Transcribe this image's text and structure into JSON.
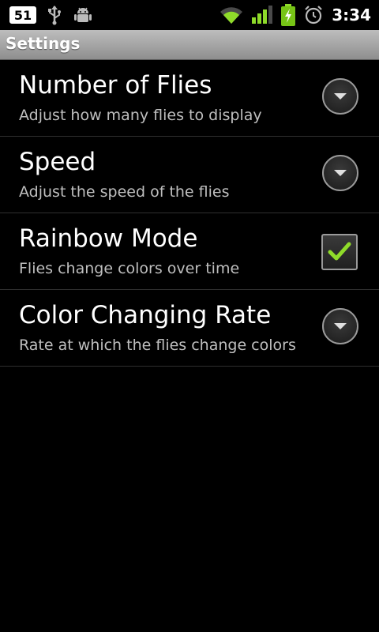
{
  "status_bar": {
    "notification_count": "51",
    "time": "3:34",
    "icons": {
      "usb": "usb-icon",
      "android_debug": "android-debug-icon",
      "wifi": "wifi-icon",
      "signal": "signal-icon",
      "battery": "battery-charging-icon",
      "alarm": "alarm-icon"
    },
    "battery_color": "#77c416"
  },
  "title_bar": {
    "title": "Settings"
  },
  "preferences": [
    {
      "title": "Number of Flies",
      "summary": "Adjust how many flies to display",
      "control": "dropdown"
    },
    {
      "title": "Speed",
      "summary": "Adjust the speed of the flies",
      "control": "dropdown"
    },
    {
      "title": "Rainbow Mode",
      "summary": "Flies change colors over time",
      "control": "checkbox",
      "checked": true
    },
    {
      "title": "Color Changing Rate",
      "summary": "Rate at which the flies change colors",
      "control": "dropdown"
    }
  ],
  "colors": {
    "check_mark": "#8fdb2a",
    "background": "#000000"
  }
}
